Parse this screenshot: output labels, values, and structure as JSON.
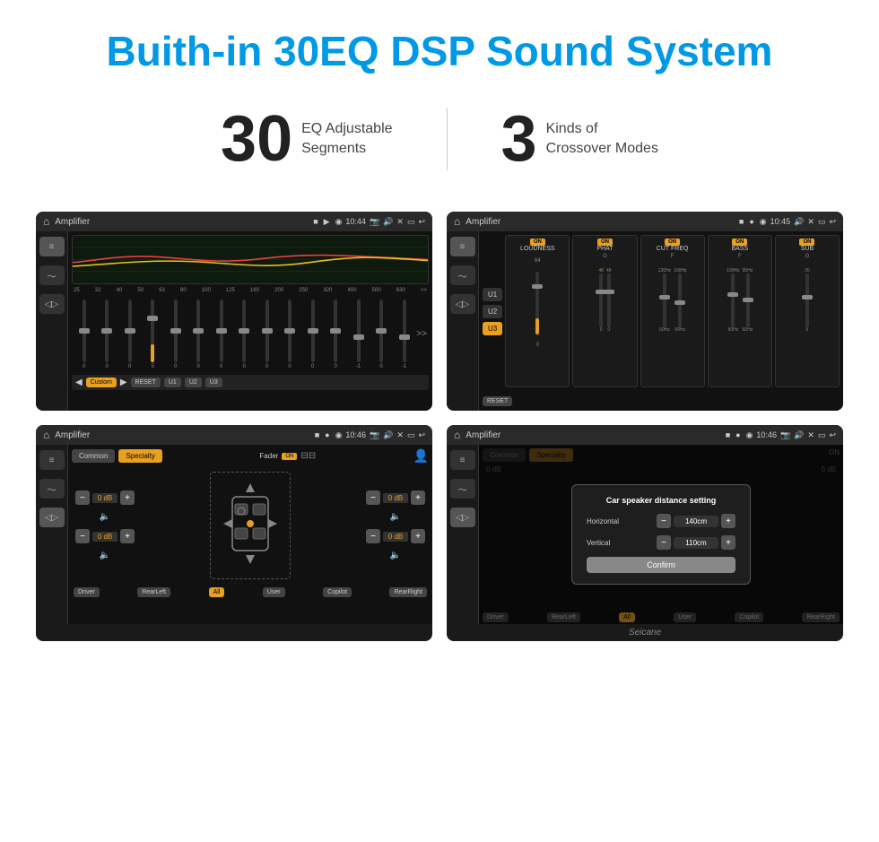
{
  "header": {
    "title": "Buith-in 30EQ DSP Sound System"
  },
  "stats": [
    {
      "number": "30",
      "desc_line1": "EQ Adjustable",
      "desc_line2": "Segments"
    },
    {
      "number": "3",
      "desc_line1": "Kinds of",
      "desc_line2": "Crossover Modes"
    }
  ],
  "screens": [
    {
      "id": "eq-screen",
      "topbar": {
        "title": "Amplifier",
        "time": "10:44"
      },
      "eq_labels": [
        "25",
        "32",
        "40",
        "50",
        "63",
        "80",
        "100",
        "125",
        "160",
        "200",
        "250",
        "320",
        "400",
        "500",
        "630"
      ],
      "eq_values": [
        "0",
        "0",
        "0",
        "5",
        "0",
        "0",
        "0",
        "0",
        "0",
        "0",
        "0",
        "0",
        "-1",
        "0",
        "-1"
      ],
      "bottom_buttons": [
        "Custom",
        "RESET",
        "U1",
        "U2",
        "U3"
      ]
    },
    {
      "id": "crossover-screen",
      "topbar": {
        "title": "Amplifier",
        "time": "10:45"
      },
      "sections": [
        "LOUDNESS",
        "PHAT",
        "CUT FREQ",
        "BASS",
        "SUB"
      ],
      "u_buttons": [
        "U1",
        "U2",
        "U3"
      ],
      "reset_label": "RESET"
    },
    {
      "id": "specialty-screen",
      "topbar": {
        "title": "Amplifier",
        "time": "10:46"
      },
      "mode_buttons": [
        "Common",
        "Specialty"
      ],
      "fader_label": "Fader",
      "zone_labels": [
        "Driver",
        "RearLeft",
        "All",
        "User",
        "Copilot",
        "RearRight"
      ],
      "db_labels": [
        "0 dB",
        "0 dB",
        "0 dB",
        "0 dB"
      ]
    },
    {
      "id": "distance-screen",
      "topbar": {
        "title": "Amplifier",
        "time": "10:46"
      },
      "mode_buttons": [
        "Common",
        "Specialty"
      ],
      "dialog": {
        "title": "Car speaker distance setting",
        "horizontal_label": "Horizontal",
        "horizontal_value": "140cm",
        "vertical_label": "Vertical",
        "vertical_value": "110cm",
        "confirm_label": "Confirm"
      },
      "zone_labels": [
        "Driver",
        "RearLeft",
        "All",
        "User",
        "Copilot",
        "RearRight"
      ],
      "db_labels": [
        "0 dB",
        "0 dB"
      ]
    }
  ],
  "watermark": "Seicane"
}
